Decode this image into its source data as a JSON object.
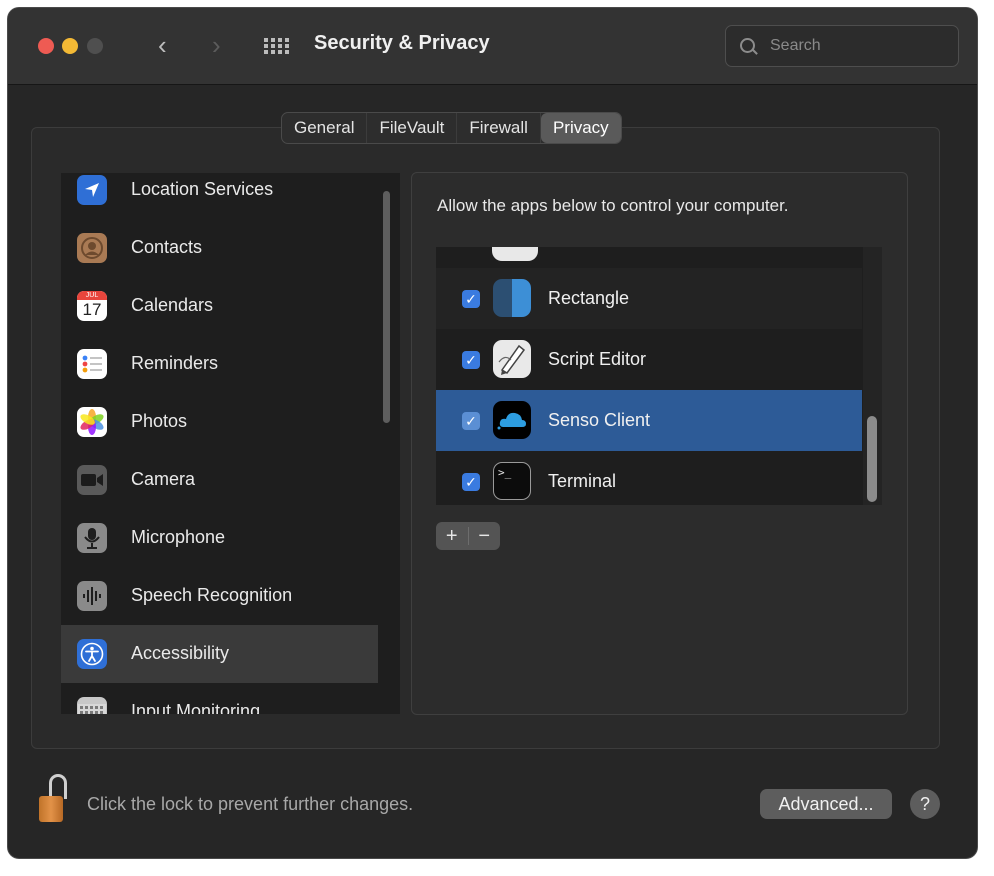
{
  "window": {
    "title": "Security & Privacy",
    "search": {
      "placeholder": "Search",
      "icon": "search-icon"
    },
    "nav": {
      "back_glyph": "‹",
      "forward_glyph": "›"
    }
  },
  "tabs": [
    {
      "label": "General",
      "active": false
    },
    {
      "label": "FileVault",
      "active": false
    },
    {
      "label": "Firewall",
      "active": false
    },
    {
      "label": "Privacy",
      "active": true
    }
  ],
  "sidebar": {
    "items": [
      {
        "label": "Location Services",
        "icon": "location-arrow-icon"
      },
      {
        "label": "Contacts",
        "icon": "contacts-icon"
      },
      {
        "label": "Calendars",
        "icon": "calendar-icon",
        "icon_month": "JUL",
        "icon_day": "17"
      },
      {
        "label": "Reminders",
        "icon": "reminders-icon"
      },
      {
        "label": "Photos",
        "icon": "photos-icon"
      },
      {
        "label": "Camera",
        "icon": "camera-icon"
      },
      {
        "label": "Microphone",
        "icon": "microphone-icon"
      },
      {
        "label": "Speech Recognition",
        "icon": "speech-waveform-icon"
      },
      {
        "label": "Accessibility",
        "icon": "accessibility-icon",
        "selected": true
      },
      {
        "label": "Input Monitoring",
        "icon": "keyboard-icon"
      }
    ]
  },
  "main": {
    "description": "Allow the apps below to control your computer.",
    "apps": [
      {
        "label": "Rectangle",
        "checked": true,
        "icon": "rectangle-app-icon"
      },
      {
        "label": "Script Editor",
        "checked": true,
        "icon": "script-editor-icon"
      },
      {
        "label": "Senso Client",
        "checked": true,
        "icon": "senso-cloud-icon",
        "selected": true
      },
      {
        "label": "Terminal",
        "checked": true,
        "icon": "terminal-icon",
        "terminal_prompt": ">_"
      }
    ],
    "add_label": "+",
    "remove_label": "−"
  },
  "footer": {
    "lock_text": "Click the lock to prevent further changes.",
    "advanced_label": "Advanced...",
    "help_label": "?"
  },
  "colors": {
    "selection_blue": "#2d5b97",
    "checkbox_blue": "#3a7be0",
    "close": "#ee5b53",
    "minimize": "#f3b935",
    "maximize_inactive": "#4f4f4f"
  }
}
